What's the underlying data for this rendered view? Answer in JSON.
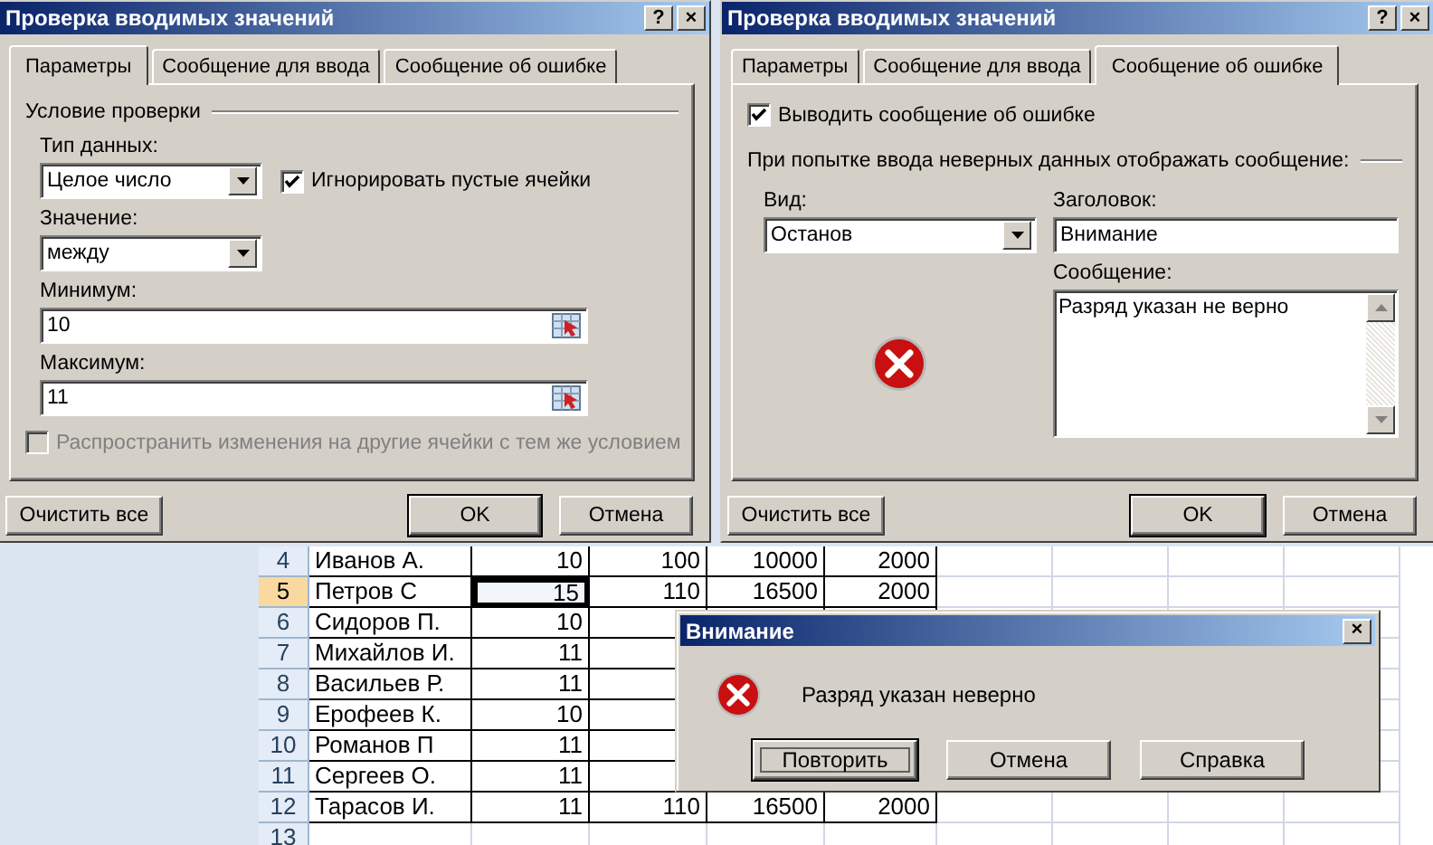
{
  "settings_dialog": {
    "title": "Проверка вводимых значений",
    "help_button": "?",
    "close_button": "×",
    "tabs": [
      {
        "label": "Параметры",
        "selected": true
      },
      {
        "label": "Сообщение для ввода",
        "selected": false
      },
      {
        "label": "Сообщение об ошибке",
        "selected": false
      }
    ],
    "group_label": "Условие проверки",
    "data_type": {
      "label": "Тип данных:",
      "value": "Целое число"
    },
    "ignore_blank": {
      "label": "Игнорировать пустые ячейки",
      "checked": true
    },
    "condition": {
      "label": "Значение:",
      "value": "между"
    },
    "minimum": {
      "label": "Минимум:",
      "value": "10"
    },
    "maximum": {
      "label": "Максимум:",
      "value": "11"
    },
    "apply_all": {
      "label": "Распространить изменения на другие ячейки с тем же условием",
      "checked": false,
      "disabled": true
    },
    "buttons": [
      {
        "label": "Очистить все",
        "default": false
      },
      {
        "label": "OK",
        "default": true
      },
      {
        "label": "Отмена",
        "default": false
      }
    ]
  },
  "error_dialog": {
    "title": "Проверка вводимых значений",
    "help_button": "?",
    "close_button": "×",
    "tabs": [
      {
        "label": "Параметры",
        "selected": false
      },
      {
        "label": "Сообщение для ввода",
        "selected": false
      },
      {
        "label": "Сообщение об ошибке",
        "selected": true
      }
    ],
    "show_error": {
      "label": "Выводить сообщение об ошибке",
      "checked": true
    },
    "group_label": "При попытке ввода неверных данных отображать сообщение:",
    "style": {
      "label": "Вид:",
      "value": "Останов"
    },
    "title_field": {
      "label": "Заголовок:",
      "value": "Внимание"
    },
    "message_field": {
      "label": "Сообщение:",
      "value": "Разряд указан не верно"
    },
    "buttons": [
      {
        "label": "Очистить все",
        "default": false
      },
      {
        "label": "OK",
        "default": true
      },
      {
        "label": "Отмена",
        "default": false
      }
    ]
  },
  "sheet": {
    "rows": [
      {
        "header": "4",
        "selected": false,
        "cells": [
          {
            "text": "Иванов А.",
            "selected": false
          },
          {
            "text": "10",
            "selected": false
          },
          {
            "text": "100",
            "selected": false
          },
          {
            "text": "10000",
            "selected": false
          },
          {
            "text": "2000",
            "selected": false
          }
        ]
      },
      {
        "header": "5",
        "selected": true,
        "cells": [
          {
            "text": "Петров С",
            "selected": false
          },
          {
            "text": "15",
            "selected": true
          },
          {
            "text": "110",
            "selected": false
          },
          {
            "text": "16500",
            "selected": false
          },
          {
            "text": "2000",
            "selected": false
          }
        ]
      },
      {
        "header": "6",
        "selected": false,
        "cells": [
          {
            "text": "Сидоров П.",
            "selected": false
          },
          {
            "text": "10",
            "selected": false
          }
        ]
      },
      {
        "header": "7",
        "selected": false,
        "cells": [
          {
            "text": "Михайлов И.",
            "selected": false
          },
          {
            "text": "11",
            "selected": false
          }
        ]
      },
      {
        "header": "8",
        "selected": false,
        "cells": [
          {
            "text": "Васильев Р.",
            "selected": false
          },
          {
            "text": "11",
            "selected": false
          }
        ]
      },
      {
        "header": "9",
        "selected": false,
        "cells": [
          {
            "text": "Ерофеев К.",
            "selected": false
          },
          {
            "text": "10",
            "selected": false
          }
        ]
      },
      {
        "header": "10",
        "selected": false,
        "cells": [
          {
            "text": "Романов П",
            "selected": false
          },
          {
            "text": "11",
            "selected": false
          }
        ]
      },
      {
        "header": "11",
        "selected": false,
        "cells": [
          {
            "text": "Сергеев О.",
            "selected": false
          },
          {
            "text": "11",
            "selected": false
          }
        ]
      },
      {
        "header": "12",
        "selected": false,
        "cells": [
          {
            "text": "Тарасов И.",
            "selected": false
          },
          {
            "text": "11",
            "selected": false
          },
          {
            "text": "110",
            "selected": false
          },
          {
            "text": "16500",
            "selected": false
          },
          {
            "text": "2000",
            "selected": false
          }
        ]
      },
      {
        "header": "13",
        "selected": false
      }
    ]
  },
  "message_box": {
    "title": "Внимание",
    "close_button": "×",
    "message": "Разряд указан неверно",
    "buttons": [
      {
        "label": "Повторить",
        "default": true
      },
      {
        "label": "Отмена",
        "default": false
      },
      {
        "label": "Справка",
        "default": false
      }
    ]
  }
}
